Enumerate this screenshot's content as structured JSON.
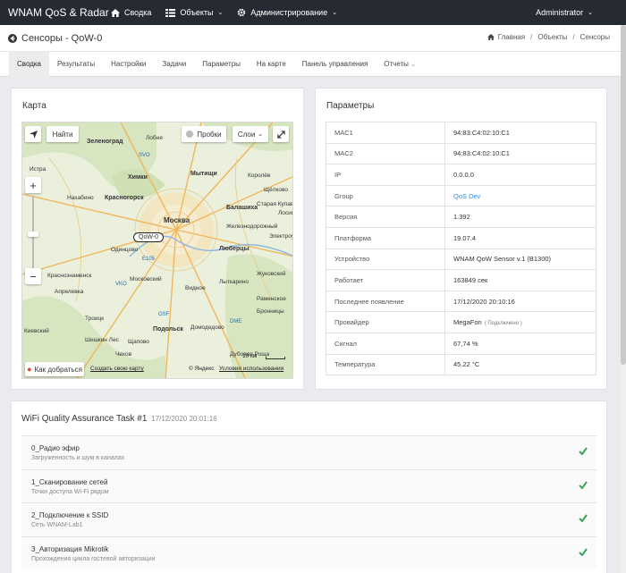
{
  "navbar": {
    "brand": "WNAM QoS & Radar",
    "items": [
      {
        "label": "Сводка"
      },
      {
        "label": "Объекты"
      },
      {
        "label": "Администрирование"
      }
    ],
    "user": "Administrator"
  },
  "header": {
    "title": "Сенсоры - QoW-0",
    "breadcrumb": [
      "Главная",
      "Объекты",
      "Сенсоры"
    ]
  },
  "tabs": [
    "Сводка",
    "Результаты",
    "Настройки",
    "Задачи",
    "Параметры",
    "На карте",
    "Панель управления",
    "Отчеты"
  ],
  "map_card": {
    "title": "Карта",
    "find_label": "Найти",
    "traffic_label": "Пробки",
    "layers_label": "Слои",
    "route_label": "Как добраться",
    "create_label": "Создать свою карту",
    "copyright": "© Яндекс",
    "terms": "Условия использования",
    "scale": "10 км",
    "marker": "QoW-0",
    "places": [
      "Зеленоград",
      "Лобня",
      "Истра",
      "Химки",
      "Мытищи",
      "Красногорск",
      "Нахабино",
      "Москва",
      "Балашиха",
      "Одинцово",
      "Люберцы",
      "Краснознаменск",
      "Московский",
      "Апрелевка",
      "Видное",
      "Жуковский",
      "Подольск",
      "Домодедово",
      "Киевский",
      "Щапово",
      "Раменское",
      "Лыткарино",
      "Железнодорожный",
      "Старая Купавна",
      "Шишкин Лес",
      "Чехов",
      "Бронницы",
      "Дубовая Роща",
      "Троицк",
      "Королёв",
      "Щёлково",
      "Лосино-Петровский",
      "Электроугли"
    ],
    "badges": [
      "SVO",
      "VKO",
      "OSF",
      "DME",
      "E105"
    ]
  },
  "params_card": {
    "title": "Параметры",
    "rows": [
      {
        "key": "MAC1",
        "value": "94:83:C4:02:10:C1"
      },
      {
        "key": "MAC2",
        "value": "94:83:C4:02:10:C1"
      },
      {
        "key": "IP",
        "value": "0.0.0.0"
      },
      {
        "key": "Group",
        "value": "QoS Dev"
      },
      {
        "key": "Версия",
        "value": "1.392"
      },
      {
        "key": "Платформа",
        "value": "19.07.4"
      },
      {
        "key": "Устройство",
        "value": "WNAM QoW Sensor v.1 (B1300)"
      },
      {
        "key": "Работает",
        "value": "163849 сек"
      },
      {
        "key": "Последнее появление",
        "value": "17/12/2020 20:10:16"
      },
      {
        "key": "Провайдер",
        "value": "MegaFon"
      },
      {
        "key": "Сигнал",
        "value": "67,74 %"
      },
      {
        "key": "Температура",
        "value": "45.22 °C"
      }
    ],
    "provider_note": "( Подключено )"
  },
  "task_card": {
    "title": "WiFi Quality Assurance Task #1",
    "time": "17/12/2020 20:01:16",
    "rows": [
      {
        "name": "0_Радио эфир",
        "desc": "Загруженность и шум в каналах"
      },
      {
        "name": "1_Сканирование сетей",
        "desc": "Точки доступа Wi-Fi рядом"
      },
      {
        "name": "2_Подключение к SSID",
        "desc": "Сеть WNAM-Lab1"
      },
      {
        "name": "3_Авторизация Mikrotik",
        "desc": "Прохождения цикла гостевой авторизации"
      }
    ]
  },
  "colors": {
    "navbar": "#262b33",
    "link": "#3a8ad6",
    "success": "#3aa35a"
  }
}
